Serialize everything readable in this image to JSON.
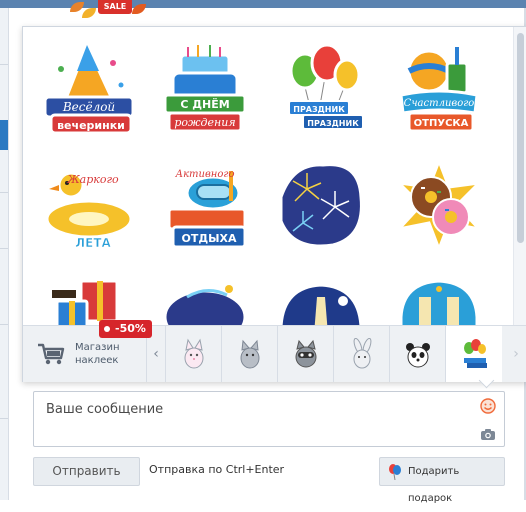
{
  "banner": {
    "sale_tag": "SALE"
  },
  "stickers": [
    {
      "name": "party",
      "lines": [
        "Весёлой",
        "вечеринки"
      ]
    },
    {
      "name": "birthday",
      "lines": [
        "С ДНЁМ",
        "рождения"
      ]
    },
    {
      "name": "holiday",
      "lines": [
        "ПРАЗДНИК",
        "ПРАЗДНИК"
      ]
    },
    {
      "name": "vacation",
      "lines": [
        "Счастливого",
        "ОТПУСКА"
      ]
    },
    {
      "name": "summer",
      "lines": [
        "Жаркого",
        "ЛЕТА"
      ]
    },
    {
      "name": "active-rest",
      "lines": [
        "Активного",
        "ОТДЫХА"
      ]
    },
    {
      "name": "fireworks",
      "lines": []
    },
    {
      "name": "donut",
      "lines": []
    }
  ],
  "shop": {
    "label": "Магазин наклеек",
    "discount": "-50%"
  },
  "composer": {
    "placeholder": "Ваше сообщение",
    "send_label": "Отправить",
    "hint": "Отправка по Ctrl+Enter",
    "gift_label": "Подарить подарок"
  }
}
